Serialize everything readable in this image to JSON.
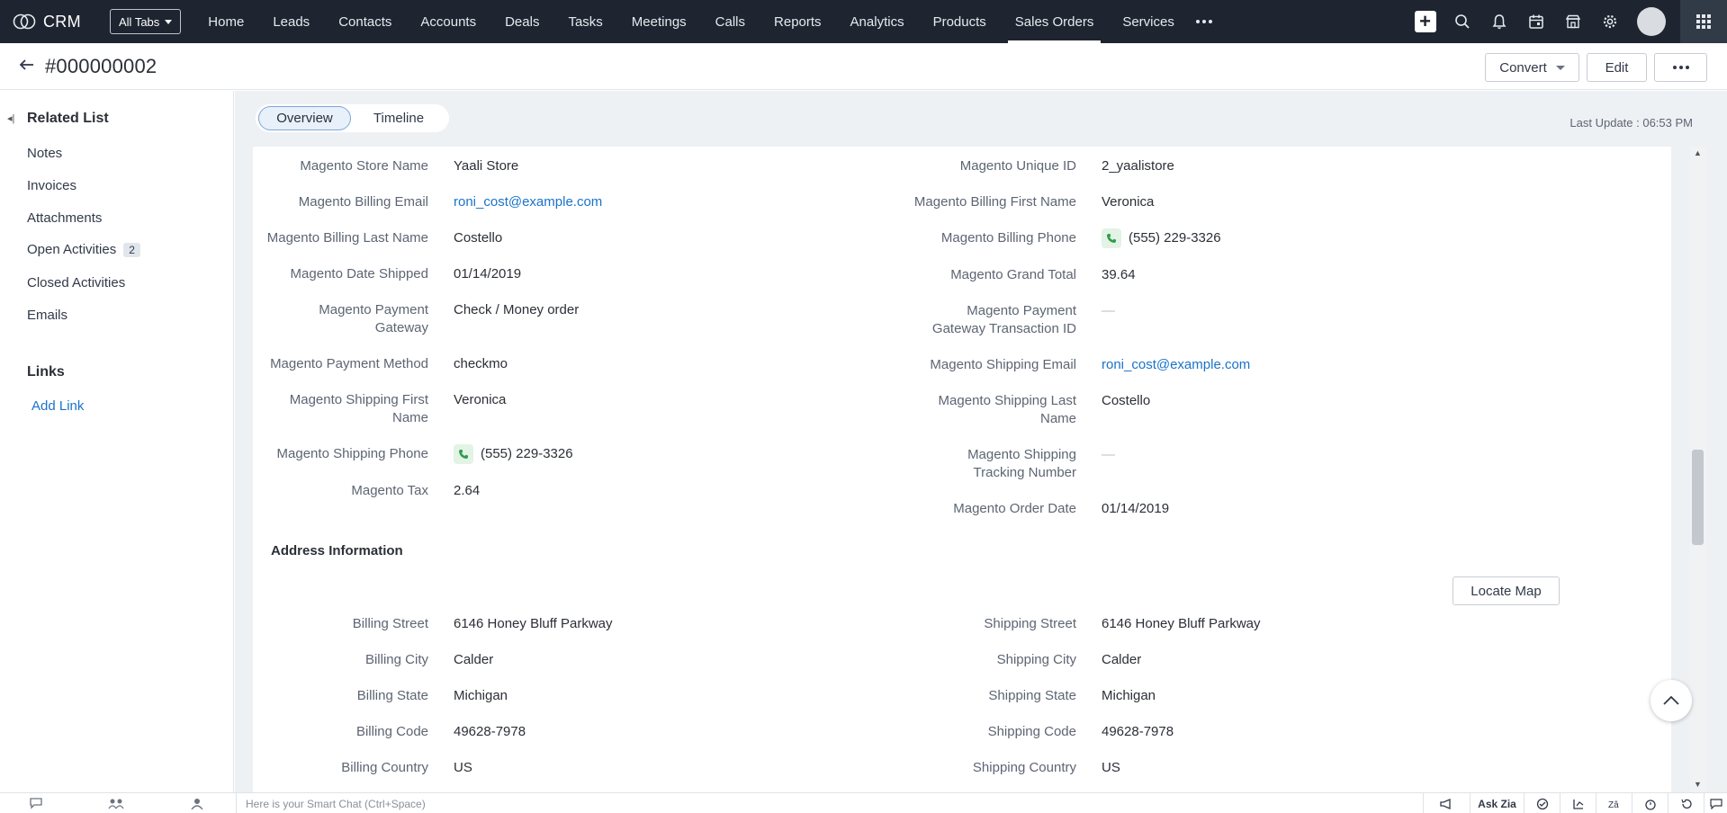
{
  "app": {
    "name": "CRM"
  },
  "nav": {
    "all_tabs": "All Tabs",
    "tabs": [
      "Home",
      "Leads",
      "Contacts",
      "Accounts",
      "Deals",
      "Tasks",
      "Meetings",
      "Calls",
      "Reports",
      "Analytics",
      "Products",
      "Sales Orders",
      "Services"
    ],
    "active_tab": "Sales Orders"
  },
  "record": {
    "title": "#000000002",
    "convert_label": "Convert",
    "edit_label": "Edit"
  },
  "sidebar": {
    "related_list_title": "Related List",
    "items": [
      {
        "label": "Notes"
      },
      {
        "label": "Invoices"
      },
      {
        "label": "Attachments"
      },
      {
        "label": "Open Activities",
        "count": "2"
      },
      {
        "label": "Closed Activities"
      },
      {
        "label": "Emails"
      }
    ],
    "links_title": "Links",
    "add_link": "Add Link"
  },
  "view_tabs": {
    "overview": "Overview",
    "timeline": "Timeline"
  },
  "last_update": "Last Update : 06:53 PM",
  "details": {
    "left": [
      {
        "label": "Magento Store Name",
        "value": "Yaali Store"
      },
      {
        "label": "Magento Billing Email",
        "value": "roni_cost@example.com"
      },
      {
        "label": "Magento Billing Last Name",
        "value": "Costello"
      },
      {
        "label": "Magento Date Shipped",
        "value": "01/14/2019"
      },
      {
        "label_1": "Magento Payment",
        "label_2": "Gateway",
        "value": "Check / Money order"
      },
      {
        "label": "Magento Payment Method",
        "value": "checkmo"
      },
      {
        "label_1": "Magento Shipping First",
        "label_2": "Name",
        "value": "Veronica"
      },
      {
        "label": "Magento Shipping Phone",
        "value": "(555) 229-3326"
      },
      {
        "label": "Magento Tax",
        "value": "2.64"
      }
    ],
    "right": [
      {
        "label": "Magento Unique ID",
        "value": "2_yaalistore"
      },
      {
        "label": "Magento Billing First Name",
        "value": "Veronica"
      },
      {
        "label": "Magento Billing Phone",
        "value": "(555) 229-3326"
      },
      {
        "label": "Magento Grand Total",
        "value": "39.64"
      },
      {
        "label_1": "Magento Payment",
        "label_2": "Gateway Transaction ID",
        "value": "—"
      },
      {
        "label": "Magento Shipping Email",
        "value": "roni_cost@example.com"
      },
      {
        "label_1": "Magento Shipping Last",
        "label_2": "Name",
        "value": "Costello"
      },
      {
        "label_1": "Magento Shipping",
        "label_2": "Tracking Number",
        "value": "—"
      },
      {
        "label": "Magento Order Date",
        "value": "01/14/2019"
      }
    ]
  },
  "address": {
    "title": "Address Information",
    "locate_map": "Locate Map",
    "left": [
      {
        "label": "Billing Street",
        "value": "6146 Honey Bluff Parkway"
      },
      {
        "label": "Billing City",
        "value": "Calder"
      },
      {
        "label": "Billing State",
        "value": "Michigan"
      },
      {
        "label": "Billing Code",
        "value": "49628-7978"
      },
      {
        "label": "Billing Country",
        "value": "US"
      }
    ],
    "right": [
      {
        "label": "Shipping Street",
        "value": "6146 Honey Bluff Parkway"
      },
      {
        "label": "Shipping City",
        "value": "Calder"
      },
      {
        "label": "Shipping State",
        "value": "Michigan"
      },
      {
        "label": "Shipping Code",
        "value": "49628-7978"
      },
      {
        "label": "Shipping Country",
        "value": "US"
      }
    ]
  },
  "bottom": {
    "smart_chat_placeholder": "Here is your Smart Chat (Ctrl+Space)",
    "ask_zia": "Ask Zia"
  }
}
